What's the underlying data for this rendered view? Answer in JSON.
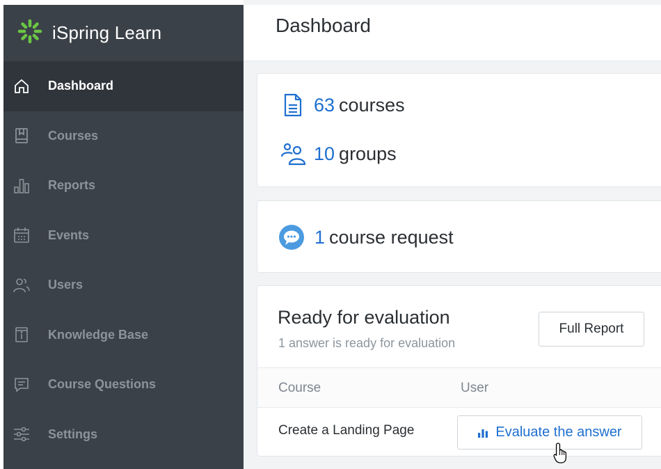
{
  "app": {
    "name": "iSpring Learn",
    "logo_icon": "ispring-sparkle-icon",
    "accent_color": "#1e6fcf",
    "logo_color": "#6cc644"
  },
  "sidebar": {
    "items": [
      {
        "label": "Dashboard",
        "icon": "home-icon",
        "active": true
      },
      {
        "label": "Courses",
        "icon": "book-icon",
        "active": false
      },
      {
        "label": "Reports",
        "icon": "bar-chart-icon",
        "active": false
      },
      {
        "label": "Events",
        "icon": "calendar-icon",
        "active": false
      },
      {
        "label": "Users",
        "icon": "users-icon",
        "active": false
      },
      {
        "label": "Knowledge Base",
        "icon": "info-book-icon",
        "active": false
      },
      {
        "label": "Course Questions",
        "icon": "chat-square-icon",
        "active": false
      },
      {
        "label": "Settings",
        "icon": "sliders-icon",
        "active": false
      }
    ]
  },
  "header": {
    "title": "Dashboard"
  },
  "stats": {
    "courses_count": "63",
    "courses_label": "courses",
    "groups_count": "10",
    "groups_label": "groups"
  },
  "requests": {
    "count": "1",
    "label": "course request"
  },
  "evaluation": {
    "title": "Ready for evaluation",
    "subtitle": "1 answer is ready for evaluation",
    "full_report_label": "Full Report",
    "columns": [
      "Course",
      "User"
    ],
    "rows": [
      {
        "course": "Create a Landing Page",
        "action_label": "Evaluate the answer"
      }
    ]
  }
}
